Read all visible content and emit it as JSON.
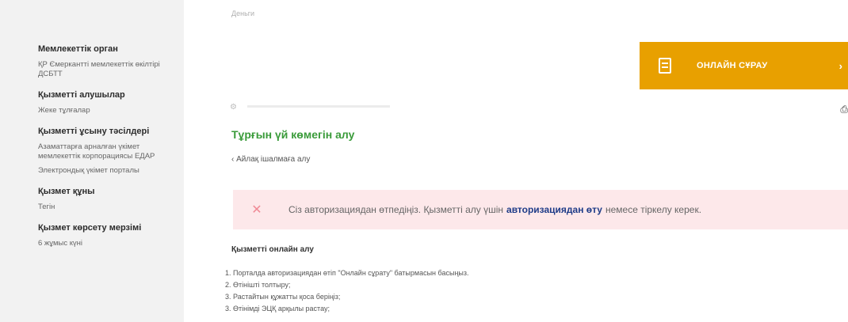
{
  "sidebar": {
    "sections": [
      {
        "title": "Мемлекеттік орган",
        "items": [
          "ҚР Ємеркантті мемлекеттік өкілтірі ДСБТТ"
        ]
      },
      {
        "title": "Қызметті алушылар",
        "items": [
          "Жеке тұлғалар"
        ]
      },
      {
        "title": "Қызметті ұсыну тәсілдері",
        "items": [
          "Азаматтарға арналған үкімет мемлекеттік корпорациясы ЕДАР",
          "Электрондық үкімет порталы"
        ]
      },
      {
        "title": "Қызмет құны",
        "items": [
          "Тегін"
        ]
      },
      {
        "title": "Қызмет көрсету мерзімі",
        "items": [
          "6 жұмыс күні"
        ]
      }
    ]
  },
  "main": {
    "top_crumb": "Деньги",
    "online_button": {
      "label": "ОНЛАЙН СҰРАУ",
      "icon": "document-icon",
      "arrow": "›"
    },
    "page_title": "Тұрғын үй көмегін алу",
    "back_link": "‹ Айлақ ішалмаға алу",
    "alert": {
      "icon": "warning-icon",
      "text": "Сіз авторизациядан өтпедіңіз. Қызметті алу үшін",
      "link": "авторизациядан өту",
      "tail": "немесе тіркелу керек.",
      "color": "#fde8ea"
    },
    "steps_title": "Қызметті онлайн алу",
    "steps": [
      "1. Порталда авторизациядан өтіп \"Онлайн сұрату\" батырмасын басыңыз.",
      "2. Өтінішті толтыру;",
      "3. Растайтын құжатты қоса беріңіз;",
      "3. Өтінімді ЭЦҚ арқылы растау;"
    ]
  },
  "colors": {
    "accent": "#e8a000",
    "title": "#3a9b3a",
    "link": "#1f3c88",
    "sidebar_bg": "#f2f2f2"
  }
}
